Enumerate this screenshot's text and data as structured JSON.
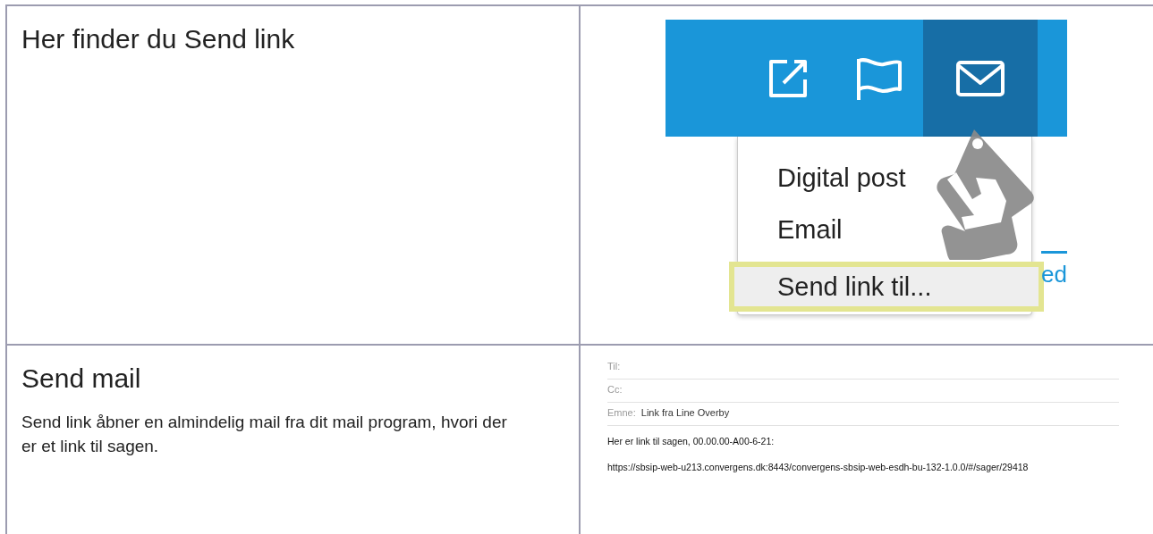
{
  "rows": [
    {
      "heading": "Her finder du Send link",
      "screenshot": {
        "kind": "menu",
        "toolbar_icons": [
          {
            "kind": "external",
            "selected": false
          },
          {
            "kind": "flag",
            "selected": false
          },
          {
            "kind": "mail",
            "selected": true
          }
        ],
        "menu_items": [
          {
            "label": "Digital post",
            "selected": false
          },
          {
            "label": "Email",
            "selected": false
          },
          {
            "label": "Send link til...",
            "selected": true
          }
        ],
        "fragment": "ed"
      }
    },
    {
      "heading": "Send mail",
      "text": "Send link åbner en almindelig mail fra dit mail program, hvori der er et link til sagen.",
      "screenshot": {
        "kind": "mail",
        "fields": [
          {
            "label": "Til:"
          },
          {
            "label": "Cc:"
          },
          {
            "label": "Emne:",
            "value": "Link fra Line Overby"
          }
        ],
        "body": [
          "Her er link til sagen, 00.00.00-A00-6-21:",
          "https://sbsip-web-u213.convergens.dk:8443/convergens-sbsip-web-esdh-bu-132-1.0.0/#/sager/29418"
        ]
      }
    }
  ]
}
